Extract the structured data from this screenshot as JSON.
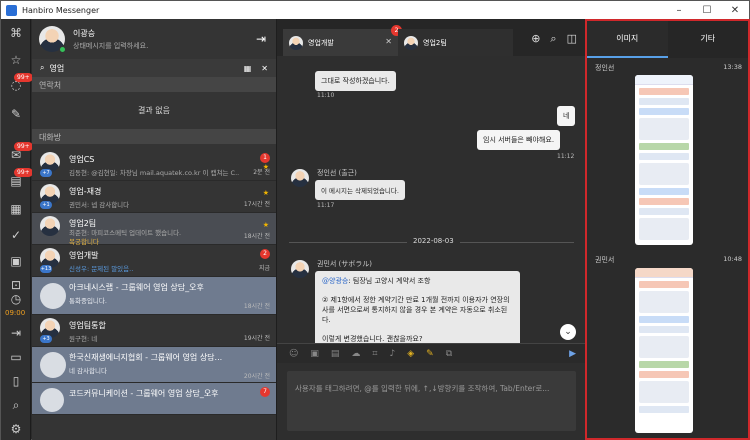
{
  "window": {
    "title": "Hanbiro Messenger"
  },
  "rail": {
    "badge_top": "99+",
    "badge_mid": "99+",
    "badge_low": "99+",
    "time": "09:00"
  },
  "profile": {
    "name": "이광승",
    "status": "상태메시지를 입력하세요."
  },
  "search": {
    "value": "영업"
  },
  "contacts": {
    "header": "연락처",
    "empty": "결과 없음"
  },
  "rooms": {
    "header": "대화방",
    "items": [
      {
        "name": "영업CS",
        "preview": "김동현: @김현일: 차장님 mail.aquatek.co.kr 이 캡쳐는 C...",
        "time": "2분 전",
        "count": "+7",
        "badge": "1"
      },
      {
        "name": "영업-재경",
        "preview": "권민서: 넵 감사합니다",
        "time": "17시간 전",
        "count": "+1"
      },
      {
        "name": "영업2팀",
        "preview": "최준현: 마피코스메틱 업데이트 했습니다.",
        "preview2": "복궁합니다",
        "time": "18시간 전",
        "count": ""
      },
      {
        "name": "영업개발",
        "preview": "신성우: 문제된 말있음..",
        "time": "지금",
        "count": "+13",
        "badge": "2"
      },
      {
        "name": "아크네시스랩 - 그룹웨어 영업 상담_오후",
        "preview": "통화중입니다.",
        "time": "18시간 전",
        "count": ""
      },
      {
        "name": "영업팀통합",
        "preview": "원구현: 네",
        "time": "19시간 전",
        "count": "+3"
      },
      {
        "name": "한국신재생에너지협회 - 그룹웨어 영업 상담...",
        "preview": "네 감사합니다",
        "time": "20시간 전",
        "count": ""
      },
      {
        "name": "코드커뮤니케이션 - 그룹웨어 영업 상담_오후",
        "preview": "",
        "time": "",
        "count": "",
        "badge": "7"
      }
    ]
  },
  "tabs": [
    {
      "name": "영업개발",
      "count": "+13",
      "badge": "2"
    },
    {
      "name": "영업2팀"
    }
  ],
  "messages": {
    "m1": {
      "text": "그대로 작성하겠습니다.",
      "time": "11:10"
    },
    "m2": {
      "text": "네"
    },
    "m3": {
      "text": "임시 서버들은 빼야해요.",
      "time": "11:12"
    },
    "m4": {
      "sender": "정인선 (출근)",
      "text": "이 메시지는 삭제되었습니다.",
      "time": "11:17"
    },
    "date": "2022-08-03",
    "m5": {
      "sender": "권민서 (サボラル)",
      "line1_mention": "@양광승",
      "line1": ": 팀장님 고양시 계약서 조항",
      "line2": "② 제1항에서 정한 계약기간 만료 1개월 전까지 이용자가 연장의사를 서면으로써 통지하지 않을 경우 본 계약은 자동으로 취소된다.",
      "line3": "이렇게 변경했습니다. 괜찮을까요?"
    }
  },
  "input": {
    "placeholder": "사용자를 태그하려면, @를 입력한 뒤에, ↑,↓방향키를 조작하여, Tab/Enter로..."
  },
  "panel": {
    "tabs": [
      "이미지",
      "기타"
    ],
    "items": [
      {
        "sender": "정인선",
        "time": "13:38"
      },
      {
        "sender": "권민서",
        "time": "10:48"
      }
    ]
  }
}
